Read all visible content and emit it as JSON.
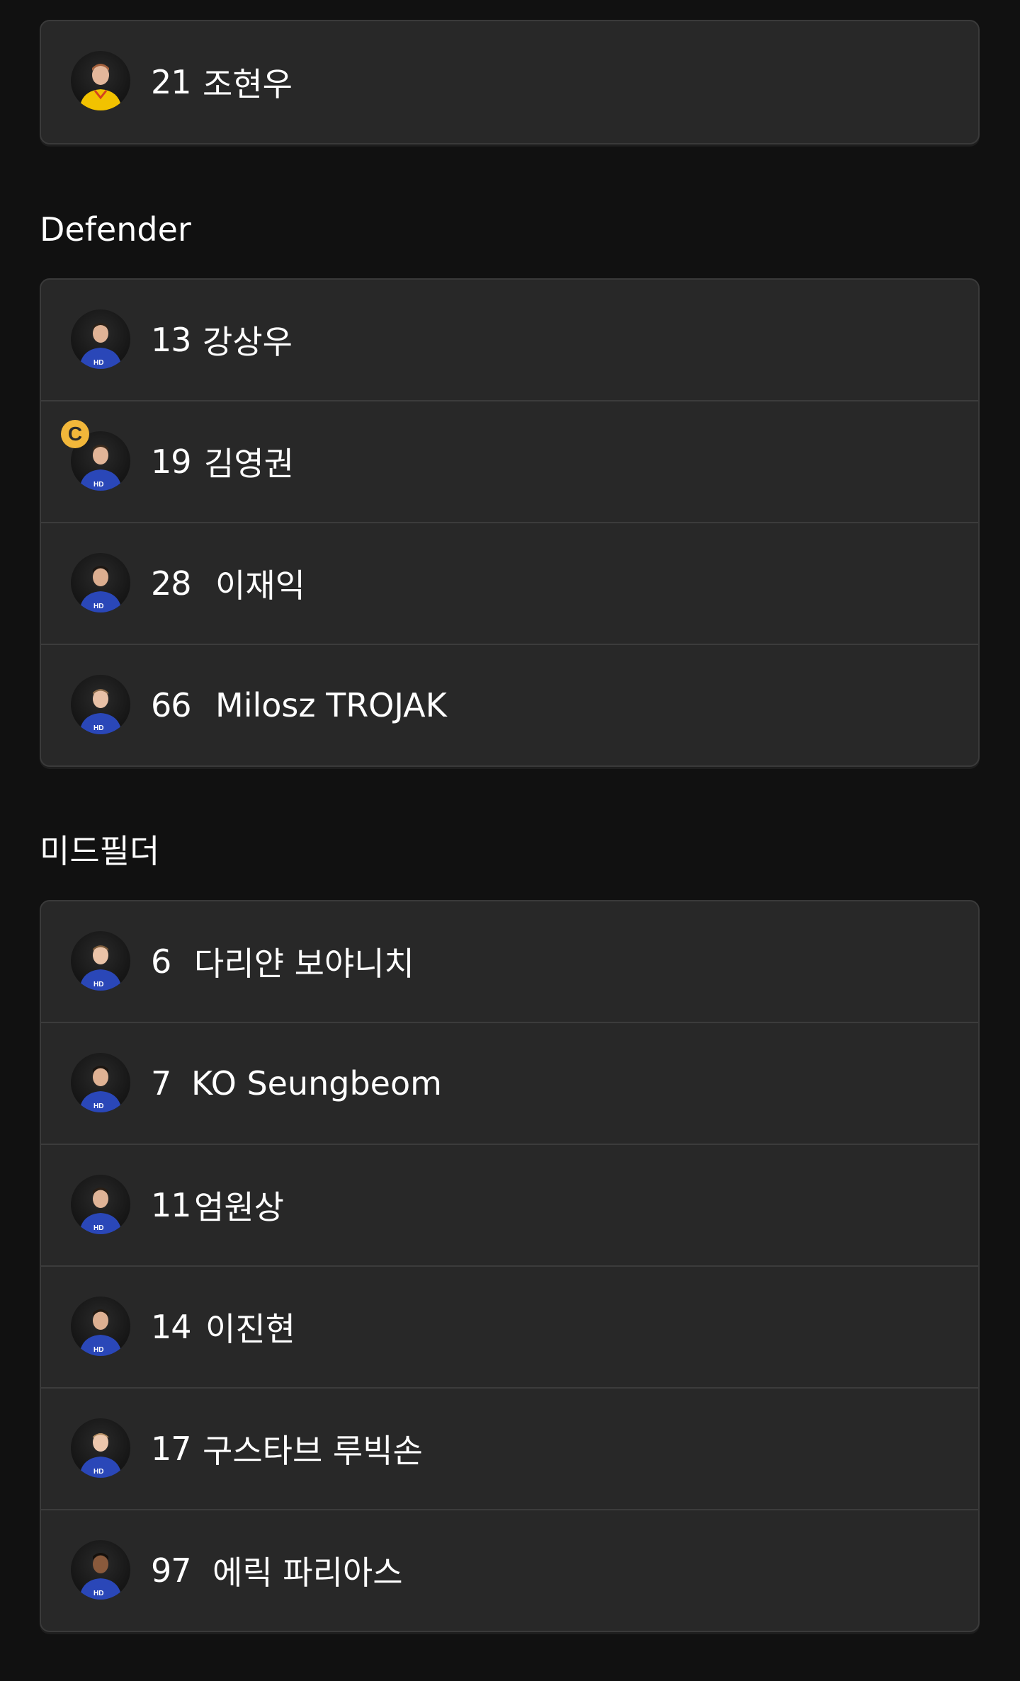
{
  "sections": [
    {
      "title": "",
      "players": [
        {
          "number": "21",
          "name": "조현우",
          "kit": "goalkeeper",
          "captain": false
        }
      ]
    },
    {
      "title": "Defender",
      "players": [
        {
          "number": "13",
          "name": "강상우",
          "kit": "outfield",
          "captain": false
        },
        {
          "number": "19",
          "name": "김영권",
          "kit": "outfield",
          "captain": true
        },
        {
          "number": "28",
          "name": "이재익",
          "kit": "outfield",
          "captain": false
        },
        {
          "number": "66",
          "name": "Milosz TROJAK",
          "kit": "outfield",
          "captain": false
        }
      ]
    },
    {
      "title": "미드필더",
      "players": [
        {
          "number": "6",
          "name": "다리얀 보야니치",
          "kit": "outfield",
          "captain": false
        },
        {
          "number": "7",
          "name": "KO Seungbeom",
          "kit": "outfield",
          "captain": false
        },
        {
          "number": "11",
          "name": "엄원상",
          "kit": "outfield",
          "captain": false
        },
        {
          "number": "14",
          "name": "이진현",
          "kit": "outfield",
          "captain": false
        },
        {
          "number": "17",
          "name": "구스타브 루빅손",
          "kit": "outfield",
          "captain": false
        },
        {
          "number": "97",
          "name": "에릭 파리아스",
          "kit": "outfield",
          "captain": false
        }
      ]
    }
  ],
  "captain_badge": {
    "label": "C",
    "icon": "captain-badge-icon"
  },
  "colors": {
    "background": "#111111",
    "card": "#282828",
    "captain_badge": "#f2b73a",
    "outfield_kit": "#2a47b8",
    "goalkeeper_kit": "#f2c200"
  }
}
